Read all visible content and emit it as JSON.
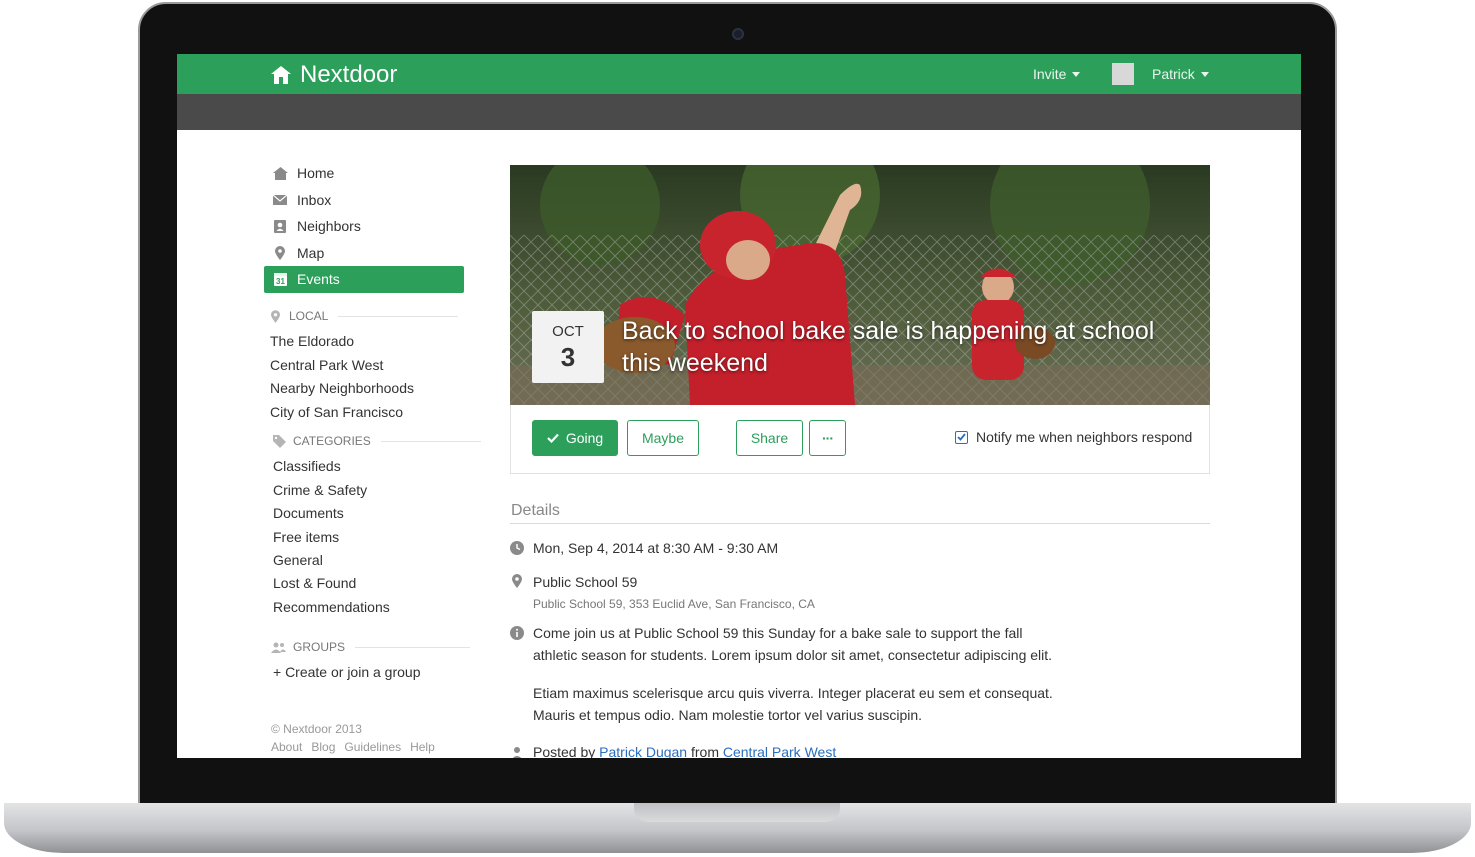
{
  "app": {
    "brand": "Nextdoor"
  },
  "topbar": {
    "invite_label": "Invite",
    "user_label": "Patrick"
  },
  "colors": {
    "brand_green": "#2c9f5b",
    "link_blue": "#2a6fbf",
    "subbar": "#4a4a4a"
  },
  "nav": [
    {
      "label": "Home",
      "icon": "home-icon"
    },
    {
      "label": "Inbox",
      "icon": "envelope-icon"
    },
    {
      "label": "Neighbors",
      "icon": "contact-card-icon"
    },
    {
      "label": "Map",
      "icon": "map-pin-icon"
    },
    {
      "label": "Events",
      "icon": "calendar-icon",
      "active": true
    }
  ],
  "local": {
    "heading": "LOCAL",
    "items": [
      "The Eldorado",
      "Central Park West",
      "Nearby Neighborhoods",
      "City of San Francisco"
    ]
  },
  "categories": {
    "heading": "CATEGORIES",
    "items": [
      "Classifieds",
      "Crime & Safety",
      "Documents",
      "Free items",
      "General",
      "Lost & Found",
      "Recommendations"
    ]
  },
  "groups": {
    "heading": "GROUPS",
    "create_label": "+ Create or join a group"
  },
  "footer": {
    "copyright": "© Nextdoor 2013",
    "links": [
      "About",
      "Blog",
      "Guidelines",
      "Help"
    ]
  },
  "event": {
    "month": "OCT",
    "day": "3",
    "title": "Back to school bake sale is happening at school this weekend",
    "actions": {
      "going": "Going",
      "maybe": "Maybe",
      "share": "Share",
      "more": "···"
    },
    "notify_label": "Notify me when neighbors respond",
    "notify_checked": true,
    "details_heading": "Details",
    "datetime": "Mon, Sep 4, 2014 at 8:30 AM - 9:30 AM",
    "location_name": "Public School 59",
    "location_address": "Public School 59, 353 Euclid Ave, San Francisco, CA",
    "description_1a": "Come join us at Public School 59 this Sunday for a bake sale to support the fall",
    "description_1b": "athletic season for students. Lorem ipsum dolor sit amet, consectetur adipiscing elit.",
    "description_2a": "Etiam maximus scelerisque arcu quis viverra. Integer placerat eu sem et consequat.",
    "description_2b": "Mauris et tempus odio. Nam molestie tortor vel varius suscipin.",
    "posted_prefix": "Posted by",
    "posted_author": "Patrick Dugan",
    "posted_middle": "from",
    "posted_place": "Central Park West"
  }
}
